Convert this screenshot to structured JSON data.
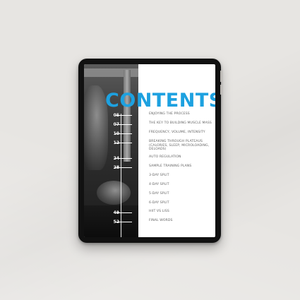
{
  "document": {
    "title": "CONTENTS",
    "page_numbers": [
      "05",
      "07",
      "10",
      "12",
      "24",
      "28",
      "49",
      "52"
    ],
    "entries": [
      "ENJOYING THE PROCESS",
      "THE KEY TO BUILDING MUSCLE MASS",
      "FREQUENCY, VOLUME, INTENSITY",
      "BREAKING THROUGH PLATEAUS (CALORIES, SLEEP, MICROLOADING, DELOADS)",
      "AUTO REGULATION",
      "SAMPLE TRAINING PLANS",
      "3-DAY SPLIT",
      "4-DAY SPLIT",
      "5-DAY SPLIT",
      "6-DAY SPLIT",
      "HIIT VS LISS",
      "FINAL WORDS"
    ]
  },
  "colors": {
    "accent": "#1da1e0",
    "background": "#e7e5e2",
    "device": "#111111"
  },
  "icons": {
    "photo": "athlete-photo"
  }
}
